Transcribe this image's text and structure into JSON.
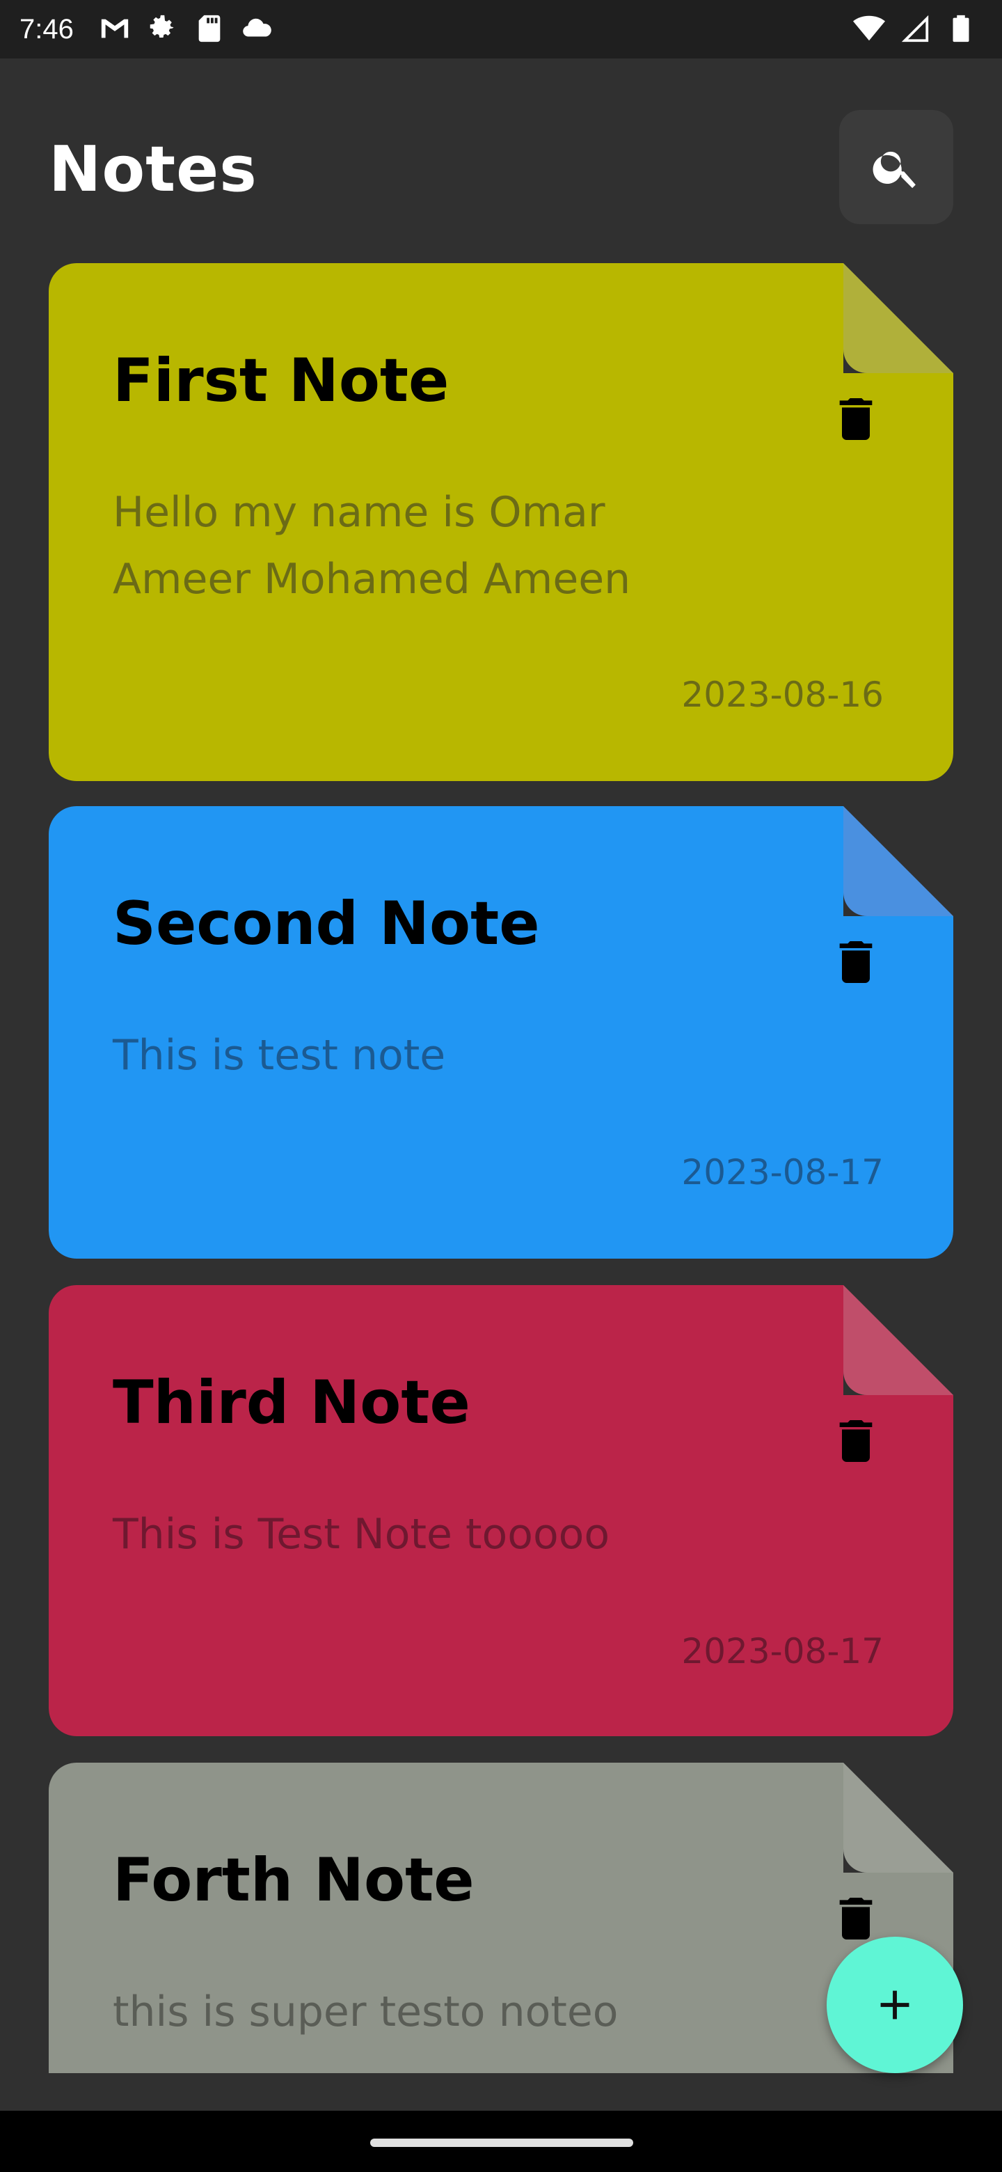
{
  "status_bar": {
    "time": "7:46",
    "left_icons": [
      "gmail-icon",
      "settings-gear-icon",
      "sd-card-icon",
      "cloud-icon"
    ],
    "right_icons": [
      "wifi-icon",
      "cell-signal-icon",
      "battery-icon"
    ]
  },
  "header": {
    "title": "Notes",
    "search_icon": "search-icon"
  },
  "notes": [
    {
      "title": "First Note",
      "content": "Hello my name is Omar Ameer Mohamed Ameen",
      "date": "2023-08-16",
      "color": "#b8b700",
      "fold_color": "#b0b03a",
      "text_color": "#6b6b16"
    },
    {
      "title": "Second Note",
      "content": "This is test note",
      "date": "2023-08-17",
      "color": "#2196f3",
      "fold_color": "#4a90e0",
      "text_color": "#1b5a92"
    },
    {
      "title": "Third Note",
      "content": "This is Test Note tooooo",
      "date": "2023-08-17",
      "color": "#bb2449",
      "fold_color": "#c04e6a",
      "text_color": "#6f1830"
    },
    {
      "title": "Forth Note",
      "content": "this is super testo noteo",
      "date": "",
      "color": "#8f948a",
      "fold_color": "#9a9e95",
      "text_color": "#5a5d56"
    }
  ],
  "fab": {
    "icon": "plus-icon"
  },
  "colors": {
    "background": "#303030",
    "accent": "#5ff5d5"
  }
}
